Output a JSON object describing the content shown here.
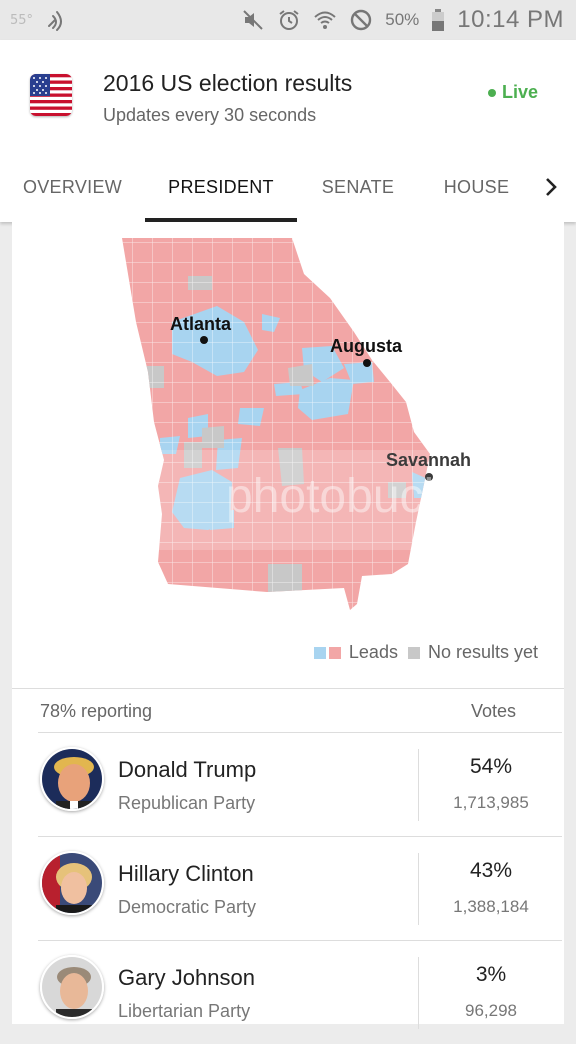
{
  "status_bar": {
    "temperature": "55°",
    "battery": "50%",
    "time": "10:14 PM",
    "icons": [
      "signal-icon",
      "mute-icon",
      "alarm-icon",
      "wifi-icon",
      "do-not-disturb-icon",
      "battery-icon"
    ]
  },
  "header": {
    "title": "2016 US election results",
    "subtitle": "Updates every 30 seconds",
    "live_label": "Live",
    "live_color": "#4caf50",
    "flag_icon": "us-flag-icon"
  },
  "tabs": [
    {
      "label": "OVERVIEW",
      "active": false
    },
    {
      "label": "PRESIDENT",
      "active": true
    },
    {
      "label": "SENATE",
      "active": false
    },
    {
      "label": "HOUSE",
      "active": false
    }
  ],
  "map": {
    "state": "Georgia",
    "cities": [
      "Atlanta",
      "Augusta",
      "Savannah"
    ],
    "watermark": "photobucket",
    "colors": {
      "republican": "#f2a6a6",
      "democrat": "#a8d4f0",
      "no_results": "#c8c8c8"
    },
    "legend": {
      "leads_label": "Leads",
      "no_results_label": "No results yet"
    }
  },
  "results": {
    "reporting": "78% reporting",
    "votes_header": "Votes",
    "candidates": [
      {
        "name": "Donald Trump",
        "party": "Republican Party",
        "percent": "54%",
        "votes": "1,713,985"
      },
      {
        "name": "Hillary Clinton",
        "party": "Democratic Party",
        "percent": "43%",
        "votes": "1,388,184"
      },
      {
        "name": "Gary Johnson",
        "party": "Libertarian Party",
        "percent": "3%",
        "votes": "96,298"
      }
    ]
  }
}
